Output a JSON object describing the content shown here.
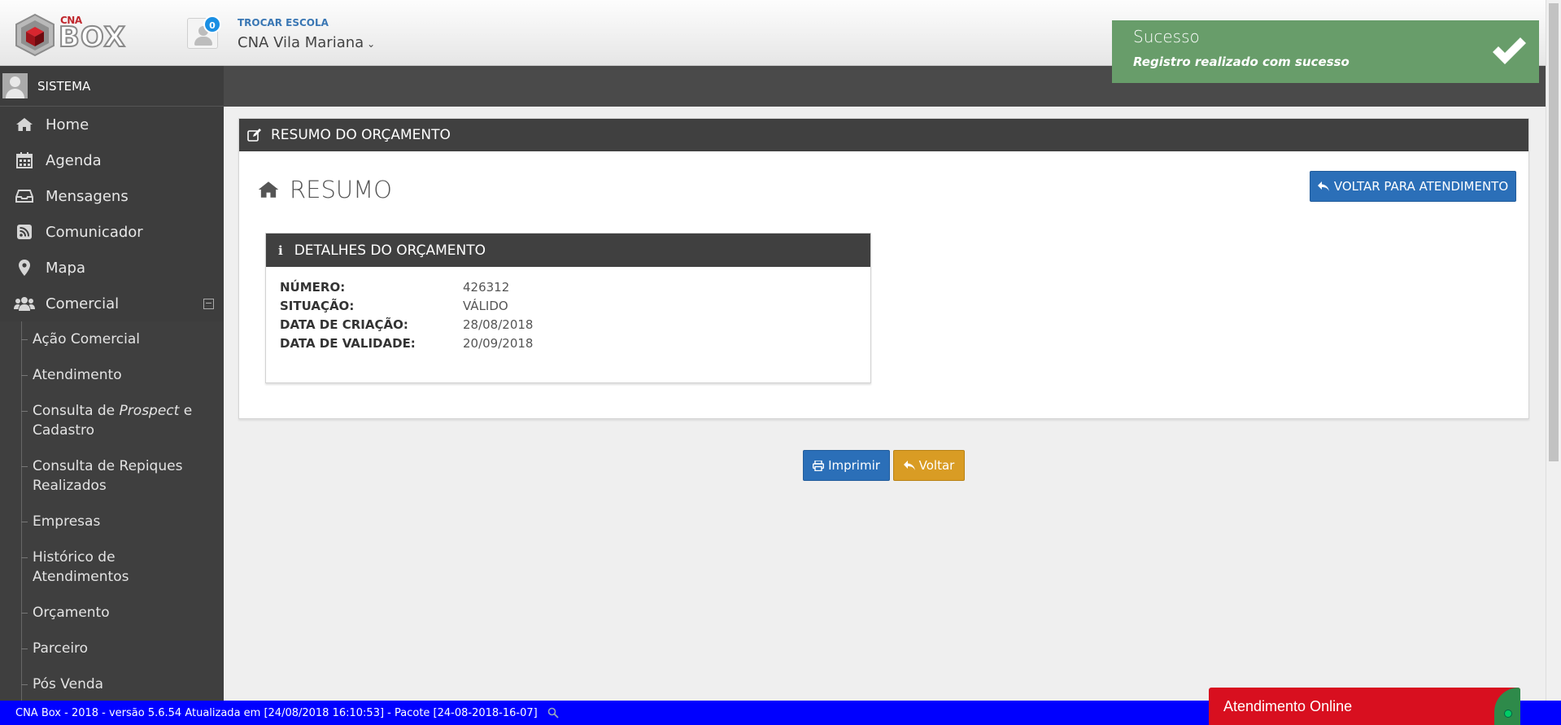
{
  "header": {
    "logo_top": "CNA",
    "logo_main": "BOX",
    "notification_count": "0",
    "school_label": "TROCAR ESCOLA",
    "school_name": "CNA Vila Mariana"
  },
  "sidebar": {
    "user": "SISTEMA",
    "items": [
      {
        "label": "Home",
        "icon": "home-icon"
      },
      {
        "label": "Agenda",
        "icon": "calendar-icon"
      },
      {
        "label": "Mensagens",
        "icon": "inbox-icon"
      },
      {
        "label": "Comunicador",
        "icon": "rss-icon"
      },
      {
        "label": "Mapa",
        "icon": "map-marker-icon"
      },
      {
        "label": "Comercial",
        "icon": "users-icon"
      }
    ],
    "collapse_symbol": "−",
    "submenu": [
      "Ação Comercial",
      "Atendimento",
      {
        "before": "Consulta de ",
        "italic": "Prospect",
        "after": " e Cadastro"
      },
      "Consulta de Repiques Realizados",
      "Empresas",
      "Histórico de Atendimentos",
      "Orçamento",
      "Parceiro",
      "Pós Venda"
    ]
  },
  "panel": {
    "header": "RESUMO DO ORÇAMENTO",
    "title": "RESUMO",
    "back_to_service_button": "VOLTAR PARA ATENDIMENTO",
    "details": {
      "header": "DETALHES DO ORÇAMENTO",
      "rows": [
        {
          "label": "NÚMERO:",
          "value": "426312"
        },
        {
          "label": "SITUAÇÃO:",
          "value": "VÁLIDO"
        },
        {
          "label": "DATA DE CRIAÇÃO:",
          "value": "28/08/2018"
        },
        {
          "label": "DATA DE VALIDADE:",
          "value": "20/09/2018"
        }
      ]
    }
  },
  "actions": {
    "print_button": "Imprimir",
    "back_button": "Voltar"
  },
  "toast": {
    "title": "Sucesso",
    "message": "Registro realizado com sucesso"
  },
  "statusbar": {
    "text": "CNA Box - 2018 - versão 5.6.54 Atualizada em [24/08/2018 16:10:53] - Pacote [24-08-2018-16-07]"
  },
  "chat": {
    "label": "Atendimento Online"
  },
  "colors": {
    "primary_button": "#2b6fb8",
    "warning_button": "#d99c24",
    "toast_success": "#689d6a",
    "statusbar": "#0000ff",
    "chat": "#d80f1f",
    "sidebar": "#3d3d3d"
  }
}
